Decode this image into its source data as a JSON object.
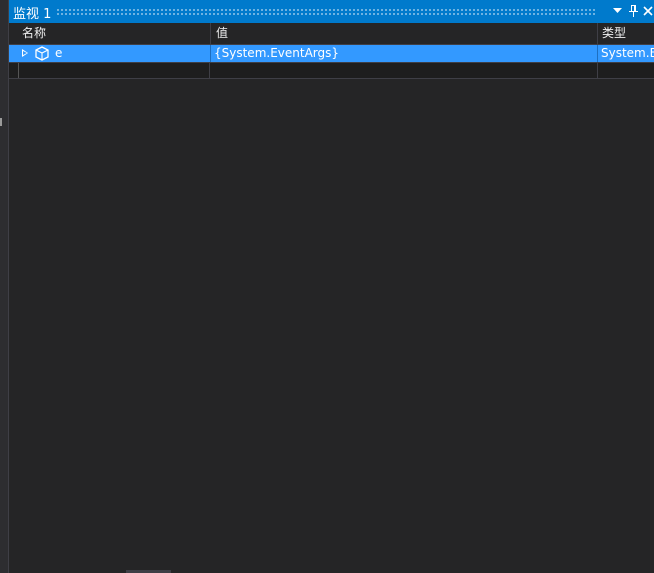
{
  "panel": {
    "title": "监视 1",
    "buttons": {
      "dropdown_icon": "chevron-down-icon",
      "pin_icon": "pin-icon",
      "close_icon": "close-icon"
    }
  },
  "columns": {
    "name": "名称",
    "value": "值",
    "type": "类型"
  },
  "rows": [
    {
      "name": "e",
      "value": "{System.EventArgs}",
      "type": "System.EventArgs",
      "icon": "object-icon",
      "expandable": true,
      "selected": true
    }
  ],
  "colors": {
    "accent": "#007acc",
    "selection": "#3399ff",
    "background": "#252526"
  }
}
